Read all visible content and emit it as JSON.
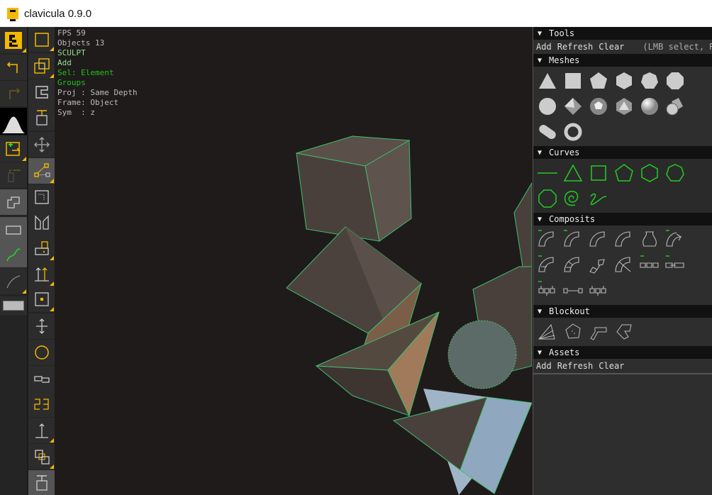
{
  "window": {
    "title": "clavicula 0.9.0"
  },
  "hud": {
    "fps": "FPS 59",
    "objects": "Objects 13",
    "mode": "SCULPT",
    "action": "Add",
    "sel": "Sel: Element",
    "groups": "Groups",
    "proj": "Proj : Same Depth",
    "frame": "Frame: Object",
    "sym": "Sym  : z"
  },
  "panel": {
    "tools": {
      "title": "Tools",
      "add": "Add",
      "refresh": "Refresh",
      "clear": "Clear",
      "hint": "(LMB select, RMB"
    },
    "meshes": {
      "title": "Meshes",
      "items": [
        "triangle",
        "square",
        "pentagon",
        "hexagon",
        "heptagon",
        "octagon",
        "circle",
        "octahedron",
        "dodecahedron",
        "icosahedron",
        "sphere",
        "cylinder",
        "capsule",
        "torus"
      ]
    },
    "curves": {
      "title": "Curves",
      "items": [
        "line",
        "triangle",
        "square",
        "pentagon",
        "hexagon",
        "heptagon",
        "octagon",
        "spiral",
        "freehand"
      ]
    },
    "composits": {
      "title": "Composits",
      "items": [
        "arc1",
        "arc2",
        "arc3",
        "arc4",
        "vase",
        "arrow",
        "arc5",
        "arc6",
        "arc7",
        "arc8",
        "chain1",
        "chain2",
        "chain3",
        "chain4",
        "chain5"
      ]
    },
    "blockout": {
      "title": "Blockout",
      "items": [
        "fan",
        "pentagon",
        "elbow",
        "hook"
      ]
    },
    "assets": {
      "title": "Assets",
      "add": "Add",
      "refresh": "Refresh",
      "clear": "Clear"
    }
  },
  "colors": {
    "accent": "#f5b800",
    "green": "#20c020",
    "panel": "#2e2e2e",
    "viewport": "#1f1b1a"
  }
}
